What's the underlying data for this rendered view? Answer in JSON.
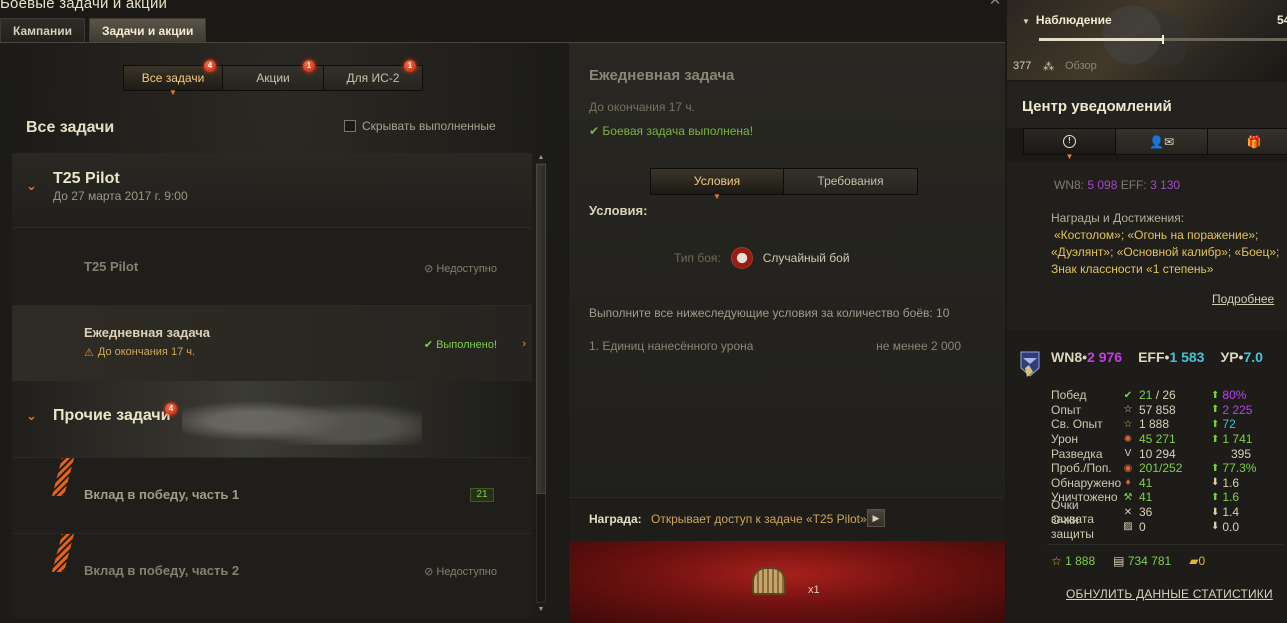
{
  "window": {
    "title": "Боевые задачи и акции",
    "close_glyph": "✕"
  },
  "top_tabs": [
    "Кампании",
    "Задачи и акции"
  ],
  "filters": [
    {
      "label": "Все задачи",
      "badge": "4"
    },
    {
      "label": "Акции",
      "badge": "1"
    },
    {
      "label": "Для ИС-2",
      "badge": "1"
    }
  ],
  "left": {
    "heading": "Все задачи",
    "hide_done_label": "Скрывать выполненные",
    "group1": {
      "title": "T25 Pilot",
      "subtitle": "До 27 марта 2017 г. 9:00"
    },
    "row1": {
      "title": "T25 Pilot",
      "status": "Недоступно"
    },
    "row2": {
      "title": "Ежедневная задача",
      "deadline": "До окончания 17 ч.",
      "status": "Выполнено!"
    },
    "group2": {
      "title": "Прочие задачи",
      "badge": "4"
    },
    "row3": {
      "title": "Вклад в победу, часть 1",
      "counter": "21"
    },
    "row4": {
      "title": "Вклад в победу, часть 2",
      "status": "Недоступно"
    }
  },
  "mid": {
    "title": "Ежедневная задача",
    "deadline": "До окончания 17 ч.",
    "done": "Боевая задача выполнена!",
    "tabs": [
      "Условия",
      "Требования"
    ],
    "conditions_label": "Условия:",
    "battle_type_label": "Тип боя:",
    "battle_type_value": "Случайный бой",
    "desc": "Выполните все нижеследующие условия за количество боёв: 10",
    "condition_name": "1. Единиц нанесённого урона",
    "condition_need": "не менее 2 000",
    "reward_label": "Награда:",
    "reward_text": "Открывает доступ к задаче «T25 Pilot»",
    "reward_count": "x1"
  },
  "right": {
    "obs_title": "Наблюдение",
    "obs_value": "54",
    "obs_level": 0.5,
    "obs_count": "377",
    "obs_review": "Обзор",
    "notif_title": "Центр уведомлений",
    "msg_wn_label": "WN8:",
    "msg_wn_value": "5 098",
    "msg_eff_label": "EFF:",
    "msg_eff_value": "3 130",
    "msg_awards_head": "Награды и Достижения:",
    "msg_awards_1": "«Костолом»; «Огонь на поражение»;",
    "msg_awards_2": "«Дуэлянт»; «Основной калибр»; «Боец»;",
    "msg_awards_3": "Знак классности «1 степень»",
    "msg_more": "Подробнее",
    "hdr_wn8_label": "WN8",
    "hdr_wn8_value": "2 976",
    "hdr_eff_label": "EFF",
    "hdr_eff_value": "1 583",
    "hdr_xvm_label": "УР",
    "hdr_xvm_value": "7.0",
    "stats": [
      {
        "k": "Побед",
        "v": "21",
        "v2": " / 26",
        "d": "80%",
        "dir": "up"
      },
      {
        "k": "Опыт",
        "v": "57 858",
        "d": "2 225",
        "dir": "up"
      },
      {
        "k": "Св. Опыт",
        "v": "1 888",
        "d": "72",
        "dir": "up"
      },
      {
        "k": "Урон",
        "v": "45 271",
        "d": "1 741",
        "dir": "up"
      },
      {
        "k": "Разведка",
        "v": "10 294",
        "d": "395",
        "dir": "none"
      },
      {
        "k": "Проб./Поп.",
        "v": "201/252",
        "d": "77.3%",
        "dir": "up"
      },
      {
        "k": "Обнаружено",
        "v": "41",
        "d": "1.6",
        "dir": "down"
      },
      {
        "k": "Уничтожено",
        "v": "41",
        "d": "1.6",
        "dir": "up"
      },
      {
        "k": "Очки захвата",
        "v": "36",
        "d": "1.4",
        "dir": "down"
      },
      {
        "k": "Очки защиты",
        "v": "0",
        "d": "0.0",
        "dir": "down"
      }
    ],
    "currency_free_xp": "1 888",
    "currency_credits": "734 781",
    "currency_gold": "0",
    "reset": "ОБНУЛИТЬ ДАННЫЕ СТАТИСТИКИ"
  }
}
